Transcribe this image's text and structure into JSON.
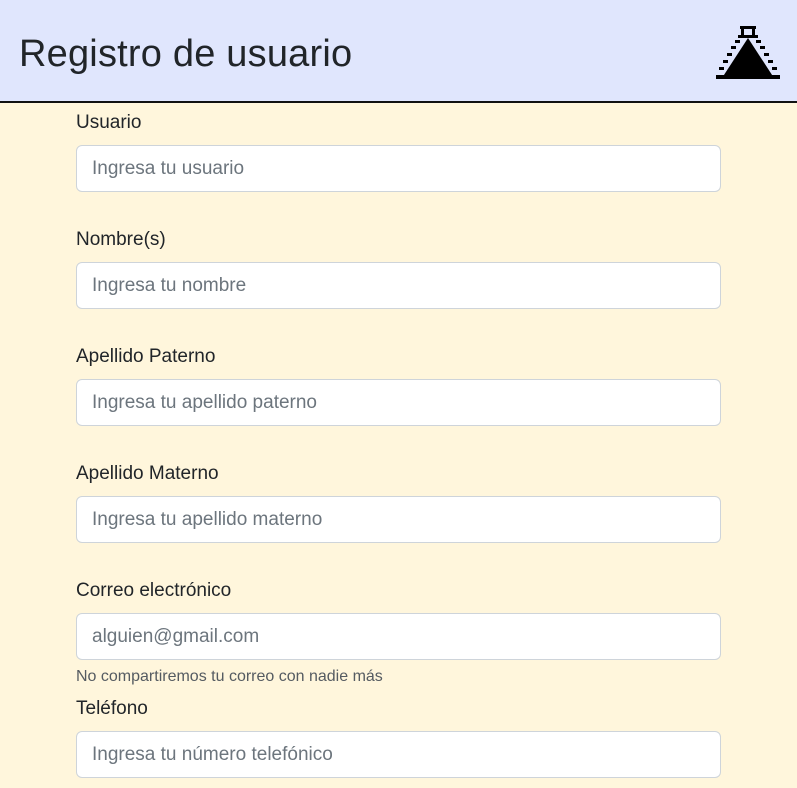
{
  "header": {
    "title": "Registro de usuario",
    "logo_icon": "pyramid-icon",
    "background": "#e0e6fd"
  },
  "page": {
    "background": "#fff6dc"
  },
  "form": {
    "usuario": {
      "label": "Usuario",
      "placeholder": "Ingresa tu usuario",
      "value": ""
    },
    "nombre": {
      "label": "Nombre(s)",
      "placeholder": "Ingresa tu nombre",
      "value": ""
    },
    "apellido_paterno": {
      "label": "Apellido Paterno",
      "placeholder": "Ingresa tu apellido paterno",
      "value": ""
    },
    "apellido_materno": {
      "label": "Apellido Materno",
      "placeholder": "Ingresa tu apellido materno",
      "value": ""
    },
    "correo": {
      "label": "Correo electrónico",
      "placeholder": "alguien@gmail.com",
      "value": "",
      "help": "No compartiremos tu correo con nadie más"
    },
    "telefono": {
      "label": "Teléfono",
      "placeholder": "Ingresa tu número telefónico",
      "value": ""
    }
  }
}
